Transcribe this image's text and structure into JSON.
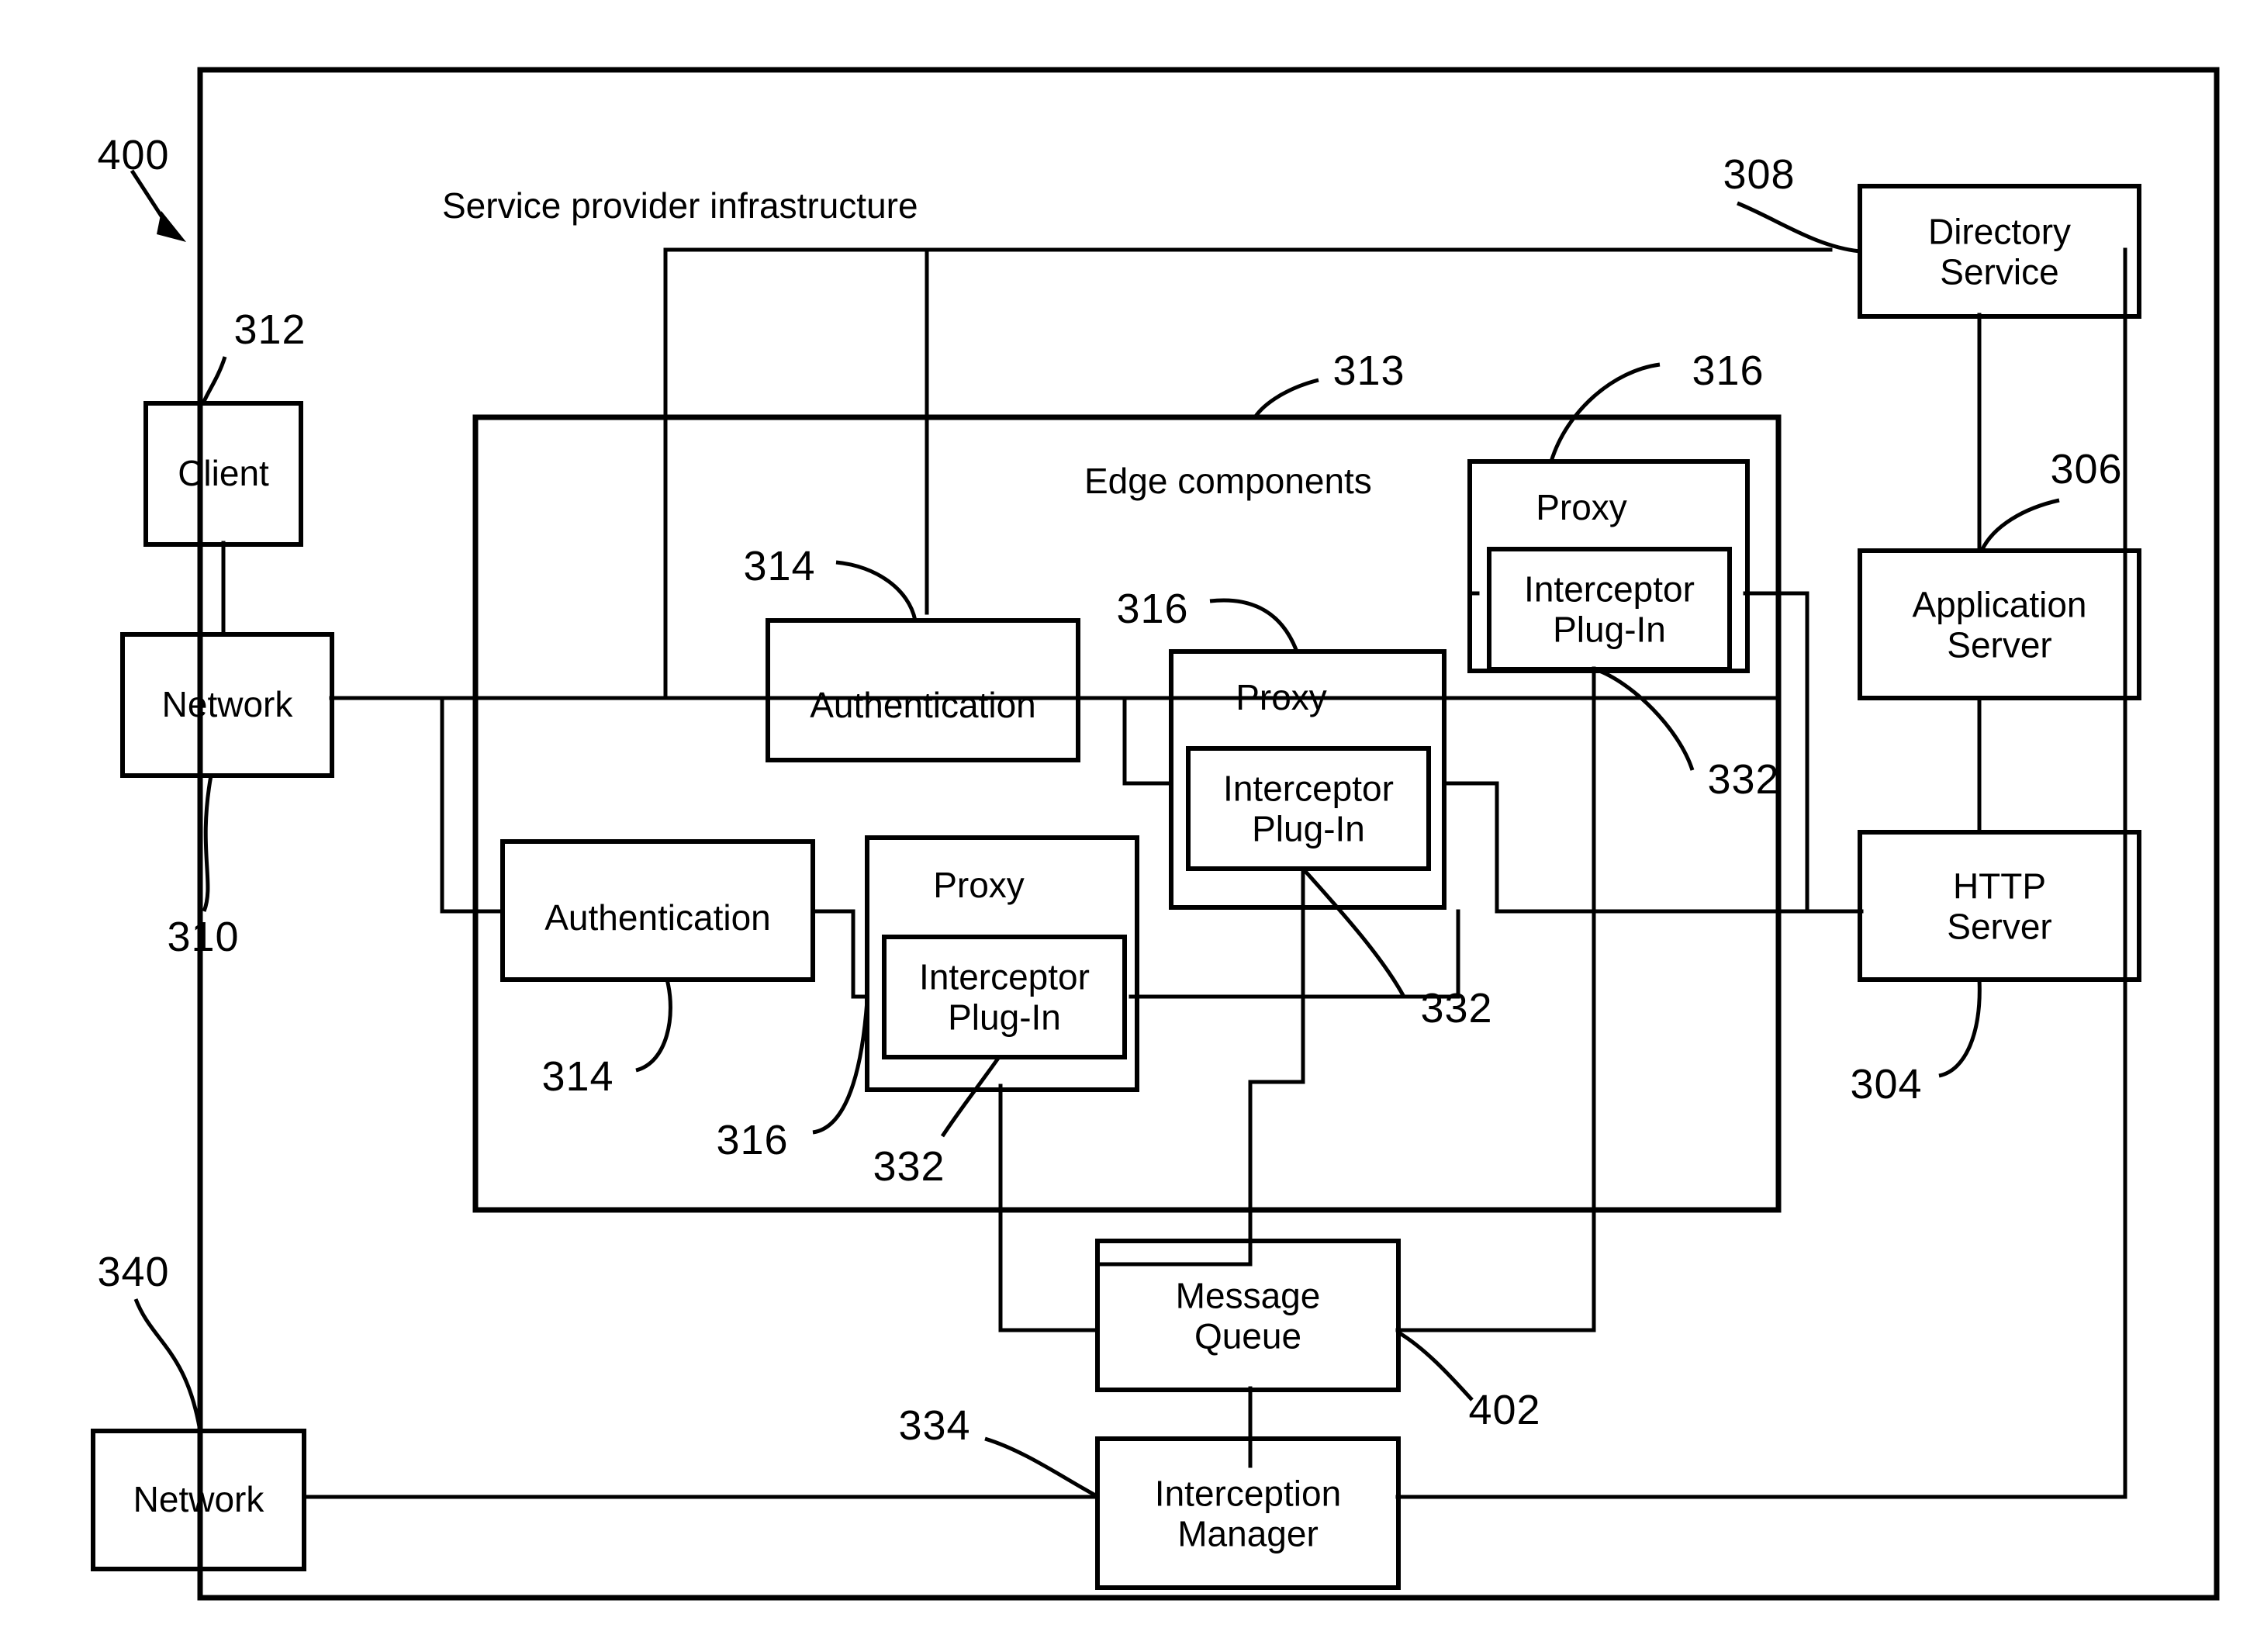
{
  "figure": {
    "reference_numeral": "400",
    "outer_group_label": "Service provider infrastructure",
    "inner_group_label": "Edge components"
  },
  "nodes": {
    "client": {
      "label": "Client",
      "ref": "312"
    },
    "network_top": {
      "label": "Network",
      "ref": "310"
    },
    "network_bottom": {
      "label": "Network",
      "ref": "340"
    },
    "auth_upper": {
      "label": "Authentication",
      "ref": "314"
    },
    "auth_lower": {
      "label": "Authentication",
      "ref": "314"
    },
    "proxy_top": {
      "label": "Proxy",
      "ref": "316",
      "child_label": "Interceptor\nPlug-In",
      "child_ref": "332"
    },
    "proxy_mid": {
      "label": "Proxy",
      "ref": "316",
      "child_label": "Interceptor\nPlug-In",
      "child_ref": "332"
    },
    "proxy_low": {
      "label": "Proxy",
      "ref": "316",
      "child_label": "Interceptor\nPlug-In",
      "child_ref": "332"
    },
    "directory_service": {
      "label": "Directory\nService",
      "ref": "308"
    },
    "application_server": {
      "label": "Application\nServer",
      "ref": "306"
    },
    "http_server": {
      "label": "HTTP\nServer",
      "ref": "304"
    },
    "message_queue": {
      "label": "Message\nQueue",
      "ref": "402"
    },
    "interception_manager": {
      "label": "Interception\nManager",
      "ref": "334"
    },
    "edge_components": {
      "label": "Edge components",
      "ref": "313"
    }
  },
  "reference_numerals": [
    {
      "id": "ref-400",
      "text": "400"
    },
    {
      "id": "ref-312",
      "text": "312"
    },
    {
      "id": "ref-310",
      "text": "310"
    },
    {
      "id": "ref-340",
      "text": "340"
    },
    {
      "id": "ref-313",
      "text": "313"
    },
    {
      "id": "ref-316-top",
      "text": "316"
    },
    {
      "id": "ref-316-mid",
      "text": "316"
    },
    {
      "id": "ref-316-low",
      "text": "316"
    },
    {
      "id": "ref-314-upper",
      "text": "314"
    },
    {
      "id": "ref-314-lower",
      "text": "314"
    },
    {
      "id": "ref-332-top",
      "text": "332"
    },
    {
      "id": "ref-332-mid",
      "text": "332"
    },
    {
      "id": "ref-332-low",
      "text": "332"
    },
    {
      "id": "ref-308",
      "text": "308"
    },
    {
      "id": "ref-306",
      "text": "306"
    },
    {
      "id": "ref-304",
      "text": "304"
    },
    {
      "id": "ref-402",
      "text": "402"
    },
    {
      "id": "ref-334",
      "text": "334"
    }
  ],
  "style": {
    "line_color": "#000000",
    "background": "#ffffff"
  }
}
